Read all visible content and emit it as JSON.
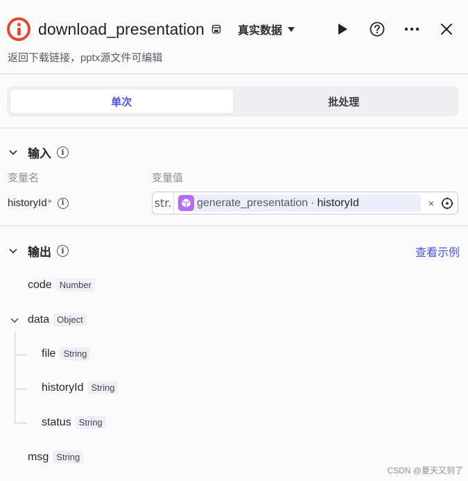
{
  "header": {
    "title": "download_presentation",
    "subtitle": "返回下载链接，pptx源文件可编辑",
    "data_mode": "真实数据",
    "icons": [
      "app-logo-icon",
      "store-icon",
      "play-icon",
      "help-icon",
      "more-icon",
      "close-icon"
    ]
  },
  "tabs": [
    {
      "label": "单次",
      "active": true
    },
    {
      "label": "批处理",
      "active": false
    }
  ],
  "input": {
    "section_title": "输入",
    "col_name": "变量名",
    "col_value": "变量值",
    "param_name": "historyId",
    "required_mark": "*",
    "type_tag": "str.",
    "ref_node": "generate_presentation",
    "ref_sep": "·",
    "ref_field": "historyId",
    "clear": "×"
  },
  "output": {
    "section_title": "输出",
    "view_example": "查看示例",
    "fields": [
      {
        "name": "code",
        "type": "Number"
      },
      {
        "name": "data",
        "type": "Object"
      },
      {
        "name": "file",
        "type": "String"
      },
      {
        "name": "historyId",
        "type": "String"
      },
      {
        "name": "status",
        "type": "String"
      },
      {
        "name": "msg",
        "type": "String"
      }
    ]
  },
  "watermark": "CSDN @夏天又到了",
  "colors": {
    "accent": "#4d53e8",
    "app_icon": "#e8462f",
    "node_icon": "#b46cf5",
    "required": "#e5484d"
  }
}
